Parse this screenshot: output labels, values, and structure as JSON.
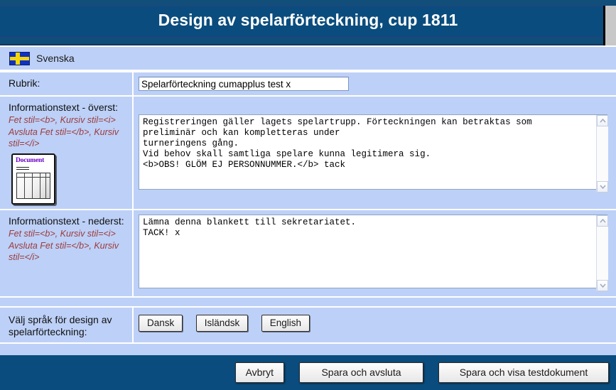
{
  "window": {
    "title": "Design av spelarförteckning, cup 1811"
  },
  "language_bar": {
    "flag_icon": "swedish-flag-icon",
    "label": "Svenska"
  },
  "form": {
    "rubrik": {
      "label": "Rubrik:",
      "value": "Spelarförteckning cumapplus test x",
      "placeholder": ""
    },
    "info_top": {
      "label": "Informationstext - överst:",
      "hint_line_1": "Fet stil=<b>, Kursiv stil=<i>",
      "hint_line_2": "Avsluta Fet stil=</b>, Kursiv stil=</i>",
      "doc_icon": "document-icon",
      "doc_icon_caption": "Document",
      "value": "Registreringen gäller lagets spelartrupp. Förteckningen kan betraktas som\npreliminär och kan kompletteras under\nturneringens gång.\nVid behov skall samtliga spelare kunna legitimera sig.\n<b>OBS! GLÖM EJ PERSONNUMMER.</b> tack"
    },
    "info_bottom": {
      "label": "Informationstext - nederst:",
      "hint_line_1": "Fet stil=<b>, Kursiv stil=<i>",
      "hint_line_2": "Avsluta Fet stil=</b>, Kursiv stil=</i>",
      "value": "Lämna denna blankett till sekretariatet.\nTACK! x"
    },
    "language_choice": {
      "label": "Välj språk för design av spelarförteckning:",
      "buttons": [
        {
          "label": "Dansk"
        },
        {
          "label": "Isländsk"
        },
        {
          "label": "English"
        }
      ]
    }
  },
  "footer": {
    "buttons": [
      {
        "label": "Avbryt"
      },
      {
        "label": "Spara och avsluta"
      },
      {
        "label": "Spara och visa testdokument"
      }
    ]
  },
  "colors": {
    "header_blue": "#0a4c7d",
    "panel_blue": "#bdd0f7",
    "hint_red": "#9c3b3b",
    "doc_title_purple": "#6b00c8",
    "flag_blue": "#1031c4",
    "flag_yellow": "#f5d70a"
  }
}
